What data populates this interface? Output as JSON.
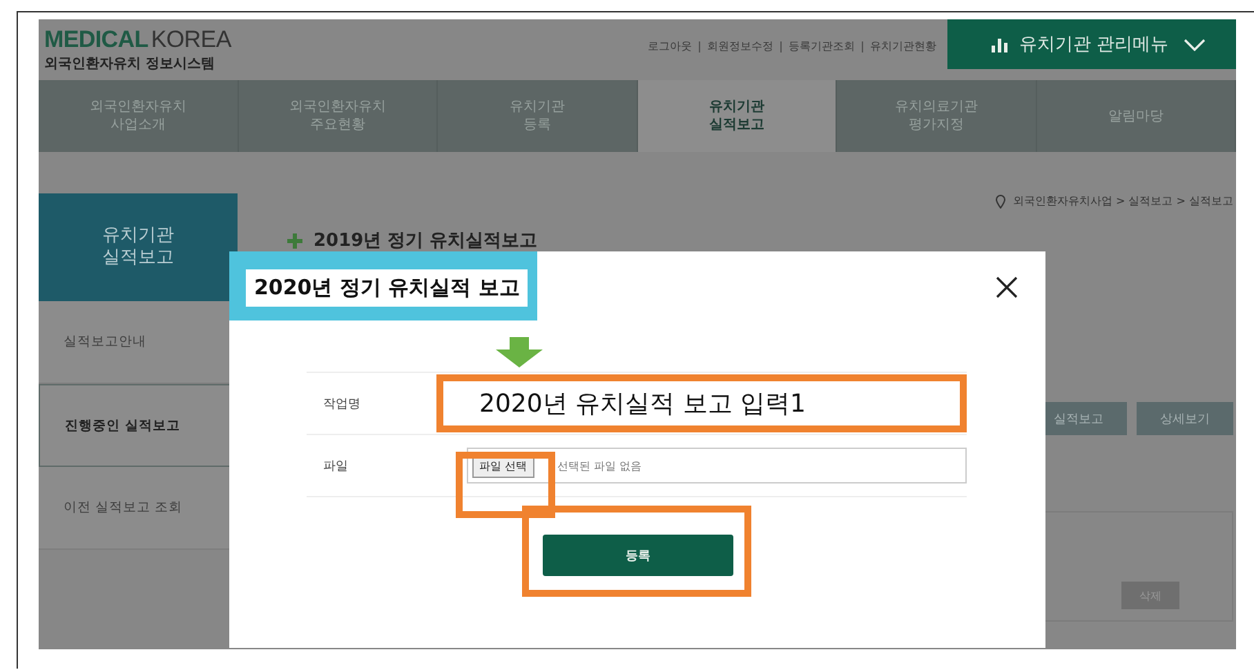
{
  "logo": {
    "brand_bold": "MEDICAL",
    "brand_light": "KOREA",
    "subtitle": "외국인환자유치 정보시스템"
  },
  "top_links": [
    "로그아웃",
    "회원정보수정",
    "등록기관조회",
    "유치기관현황"
  ],
  "menu_button": {
    "label": "유치기관 관리메뉴"
  },
  "nav_tabs": [
    {
      "lines": [
        "외국인환자유치",
        "사업소개"
      ],
      "selected": false
    },
    {
      "lines": [
        "외국인환자유치",
        "주요현황"
      ],
      "selected": false
    },
    {
      "lines": [
        "유치기관",
        "등록"
      ],
      "selected": false
    },
    {
      "lines": [
        "유치기관",
        "실적보고"
      ],
      "selected": true
    },
    {
      "lines": [
        "유치의료기관",
        "평가지정"
      ],
      "selected": false
    },
    {
      "lines": [
        "알림마당"
      ],
      "selected": false
    }
  ],
  "sidebar": {
    "title_lines": [
      "유치기관",
      "실적보고"
    ],
    "items": [
      {
        "label": "실적보고안내",
        "selected": false
      },
      {
        "label": "진행중인 실적보고",
        "selected": true
      },
      {
        "label": "이전 실적보고 조회",
        "selected": false
      }
    ]
  },
  "breadcrumb": "외국인환자유치사업 > 실적보고 > 실적보고",
  "heading": "2019년 정기 유치실적보고",
  "row_buttons": [
    "실적보고",
    "상세보기"
  ],
  "table_button": "삭제",
  "modal": {
    "callout": "2020년 정기 유치실적 보고",
    "fields": [
      {
        "kind": "text",
        "label": "작업명",
        "value": "2020년 유치실적 보고 입력1",
        "highlighted": true
      },
      {
        "kind": "file",
        "label": "파일",
        "button": "파일 선택",
        "status": "선택된 파일 없음",
        "highlighted": true
      }
    ],
    "submit": {
      "label": "등록",
      "highlighted": true
    }
  }
}
